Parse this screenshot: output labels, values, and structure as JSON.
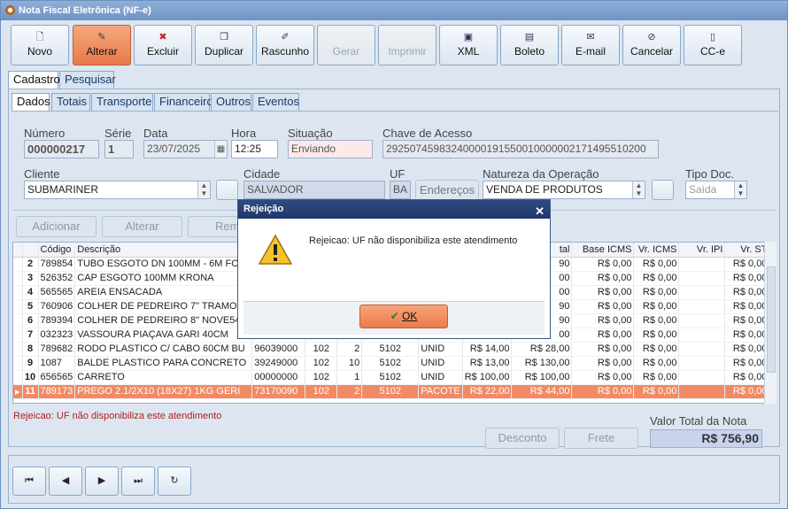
{
  "window": {
    "title": "Nota Fiscal Eletrônica (NF-e)"
  },
  "toolbar": {
    "novo": "Novo",
    "alterar": "Alterar",
    "excluir": "Excluir",
    "duplicar": "Duplicar",
    "rascunho": "Rascunho",
    "gerar": "Gerar",
    "imprimir": "Imprimir",
    "xml": "XML",
    "boleto": "Boleto",
    "email": "E-mail",
    "cancelar": "Cancelar",
    "cce": "CC-e"
  },
  "tabs_main": [
    "Cadastro",
    "Pesquisar"
  ],
  "tabs_sub": [
    "Dados",
    "Totais",
    "Transporte",
    "Financeiro",
    "Outros",
    "Eventos"
  ],
  "form": {
    "numero_label": "Número",
    "numero": "000000217",
    "serie_label": "Série",
    "serie": "1",
    "data_label": "Data",
    "data": "23/07/2025",
    "hora_label": "Hora",
    "hora": "12:25",
    "situacao_label": "Situação",
    "situacao": "Enviando",
    "chave_label": "Chave de Acesso",
    "chave": "29250745983240000191550010000002171495510200",
    "cliente_label": "Cliente",
    "cliente": "SUBMARINER",
    "cidade_label": "Cidade",
    "cidade": "SALVADOR",
    "uf_label": "UF",
    "uf": "BA",
    "enderecos": "Endereços",
    "natureza_label": "Natureza da Operação",
    "natureza": "VENDA DE PRODUTOS",
    "tipo_label": "Tipo Doc.",
    "tipo": "Saída"
  },
  "item_buttons": {
    "adicionar": "Adicionar",
    "alterar": "Alterar",
    "remover": "Rem"
  },
  "grid": {
    "headers": [
      "",
      "",
      "Código",
      "Descrição",
      "N",
      "",
      "",
      "",
      "",
      "",
      "tal",
      "Base ICMS",
      "Vr. ICMS",
      "Vr. IPI",
      "Vr. ST"
    ],
    "rows": [
      {
        "n": "2",
        "cod": "789854",
        "desc": "TUBO ESGOTO DN 100MM - 6M FOI",
        "ncm": "3",
        "cst": "",
        "cfop": "",
        "q": "",
        "u": "",
        "vu": "",
        "tot": "90",
        "bicms": "R$ 0,00",
        "vicms": "R$ 0,00",
        "vipi": "",
        "vst": "R$ 0,00"
      },
      {
        "n": "3",
        "cod": "526352",
        "desc": "CAP ESGOTO 100MM KRONA",
        "ncm": "3",
        "cst": "",
        "cfop": "",
        "q": "",
        "u": "",
        "vu": "",
        "tot": "00",
        "bicms": "R$ 0,00",
        "vicms": "R$ 0,00",
        "vipi": "",
        "vst": "R$ 0,00"
      },
      {
        "n": "4",
        "cod": "565565",
        "desc": "AREIA ENSACADA",
        "ncm": "2",
        "cst": "",
        "cfop": "",
        "q": "",
        "u": "",
        "vu": "",
        "tot": "00",
        "bicms": "R$ 0,00",
        "vicms": "R$ 0,00",
        "vipi": "",
        "vst": "R$ 0,00"
      },
      {
        "n": "5",
        "cod": "760906",
        "desc": "COLHER DE PEDREIRO 7\" TRAMONT",
        "ncm": "8",
        "cst": "",
        "cfop": "",
        "q": "",
        "u": "",
        "vu": "",
        "tot": "90",
        "bicms": "R$ 0,00",
        "vicms": "R$ 0,00",
        "vipi": "",
        "vst": "R$ 0,00"
      },
      {
        "n": "6",
        "cod": "789394",
        "desc": "COLHER DE PEDREIRO 8\" NOVE54",
        "ncm": "8",
        "cst": "",
        "cfop": "",
        "q": "",
        "u": "",
        "vu": "",
        "tot": "90",
        "bicms": "R$ 0,00",
        "vicms": "R$ 0,00",
        "vipi": "",
        "vst": "R$ 0,00"
      },
      {
        "n": "7",
        "cod": "032323",
        "desc": "VASSOURA PIAÇAVA GARI 40CM",
        "ncm": "9",
        "cst": "",
        "cfop": "",
        "q": "",
        "u": "",
        "vu": "",
        "tot": "00",
        "bicms": "R$ 0,00",
        "vicms": "R$ 0,00",
        "vipi": "",
        "vst": "R$ 0,00"
      },
      {
        "n": "8",
        "cod": "789682",
        "desc": "RODO PLASTICO C/ CABO 60CM BU",
        "ncm": "96039000",
        "cst": "102",
        "cfop": "5102",
        "q": "2",
        "u": "UNID",
        "vu": "R$ 14,00",
        "tot": "R$ 28,00",
        "bicms": "R$ 0,00",
        "vicms": "R$ 0,00",
        "vipi": "",
        "vst": "R$ 0,00"
      },
      {
        "n": "9",
        "cod": "1087",
        "desc": "BALDE PLASTICO PARA CONCRETO",
        "ncm": "39249000",
        "cst": "102",
        "cfop": "5102",
        "q": "10",
        "u": "UNID",
        "vu": "R$ 13,00",
        "tot": "R$ 130,00",
        "bicms": "R$ 0,00",
        "vicms": "R$ 0,00",
        "vipi": "",
        "vst": "R$ 0,00"
      },
      {
        "n": "10",
        "cod": "656565",
        "desc": "CARRETO",
        "ncm": "00000000",
        "cst": "102",
        "cfop": "5102",
        "q": "1",
        "u": "UNID",
        "vu": "R$ 100,00",
        "tot": "R$ 100,00",
        "bicms": "R$ 0,00",
        "vicms": "R$ 0,00",
        "vipi": "",
        "vst": "R$ 0,00"
      },
      {
        "n": "11",
        "cod": "789173",
        "desc": "PREGO 2.1/2X10 (18X27) 1KG GERI",
        "ncm": "73170090",
        "cst": "102",
        "cfop": "5102",
        "q": "2",
        "u": "PACOTE",
        "vu": "R$ 22,00",
        "tot": "R$ 44,00",
        "bicms": "R$ 0,00",
        "vicms": "R$ 0,00",
        "vipi": "",
        "vst": "R$ 0,00",
        "selected": true
      }
    ]
  },
  "error_message": "Rejeicao: UF não disponibiliza este atendimento",
  "totals": {
    "label": "Valor Total da Nota",
    "value": "R$ 756,90",
    "desconto": "Desconto",
    "frete": "Frete"
  },
  "modal": {
    "title": "Rejeição",
    "message": "Rejeicao: UF não disponibiliza este atendimento",
    "ok": "OK"
  }
}
